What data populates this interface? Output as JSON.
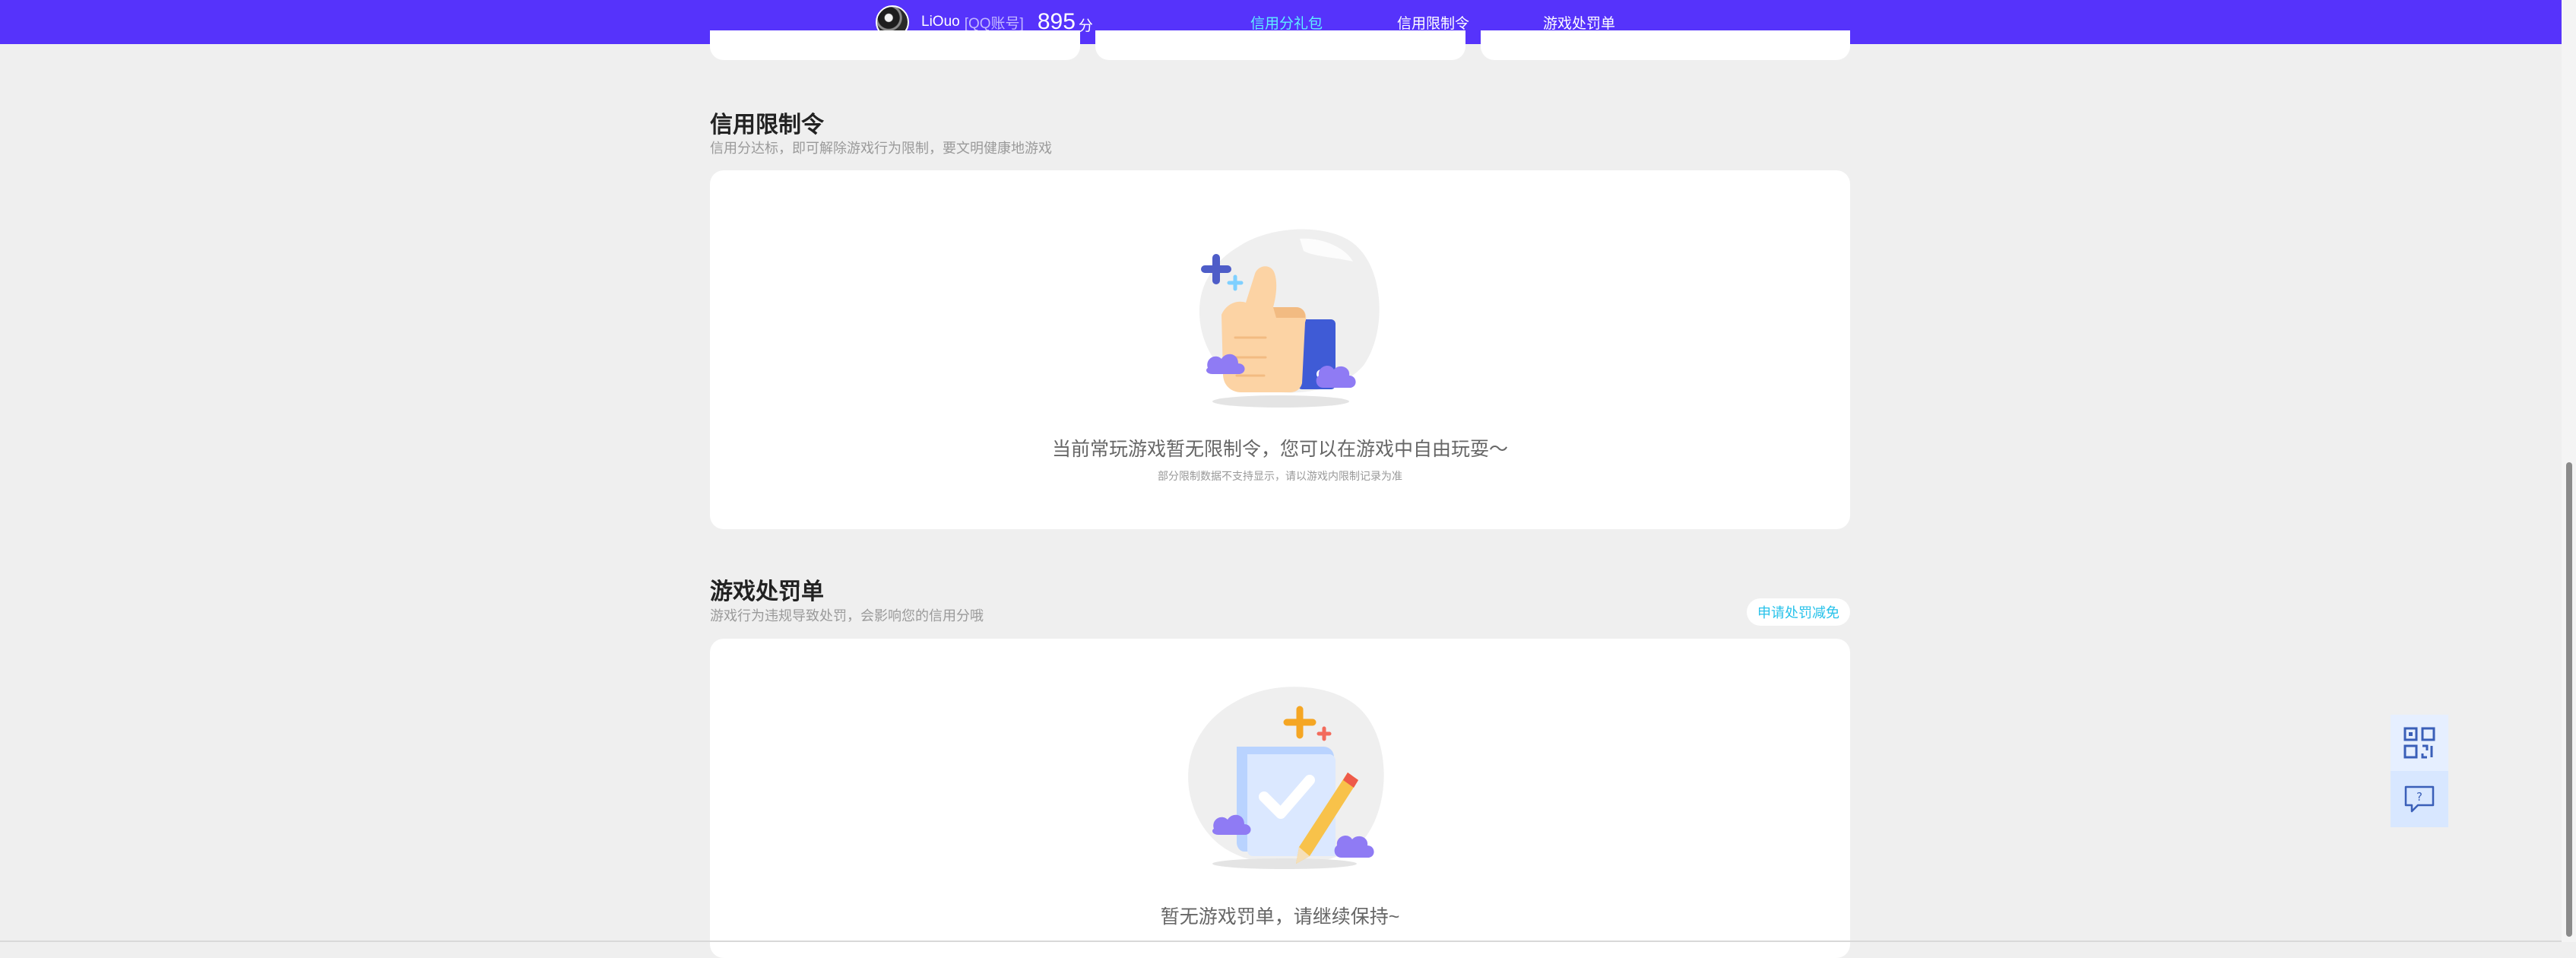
{
  "header": {
    "username": "LiOuo",
    "account_type": "[QQ账号]",
    "score": "895",
    "score_unit": "分",
    "nav": [
      {
        "label": "信用分礼包",
        "active": true
      },
      {
        "label": "信用限制令",
        "active": false
      },
      {
        "label": "游戏处罚单",
        "active": false
      }
    ]
  },
  "credit_limit": {
    "title": "信用限制令",
    "subtitle": "信用分达标，即可解除游戏行为限制，要文明健康地游戏",
    "empty_text": "当前常玩游戏暂无限制令，您可以在游戏中自由玩耍～",
    "empty_hint": "部分限制数据不支持显示，请以游戏内限制记录为准",
    "illustration_icon": "thumbs-up-icon"
  },
  "penalty": {
    "title": "游戏处罚单",
    "subtitle": "游戏行为违规导致处罚，会影响您的信用分哦",
    "apply_button": "申请处罚减免",
    "empty_text": "暂无游戏罚单，请继续保持~",
    "illustration_icon": "clipboard-check-icon"
  },
  "float_tools": {
    "qr_icon": "qr-code-icon",
    "feedback_icon": "feedback-icon",
    "feedback_glyph": "?"
  },
  "colors": {
    "header_bg": "#5633fb",
    "nav_active": "#5ff0ff",
    "accent_link": "#27c2ea",
    "page_bg": "#efefef"
  }
}
